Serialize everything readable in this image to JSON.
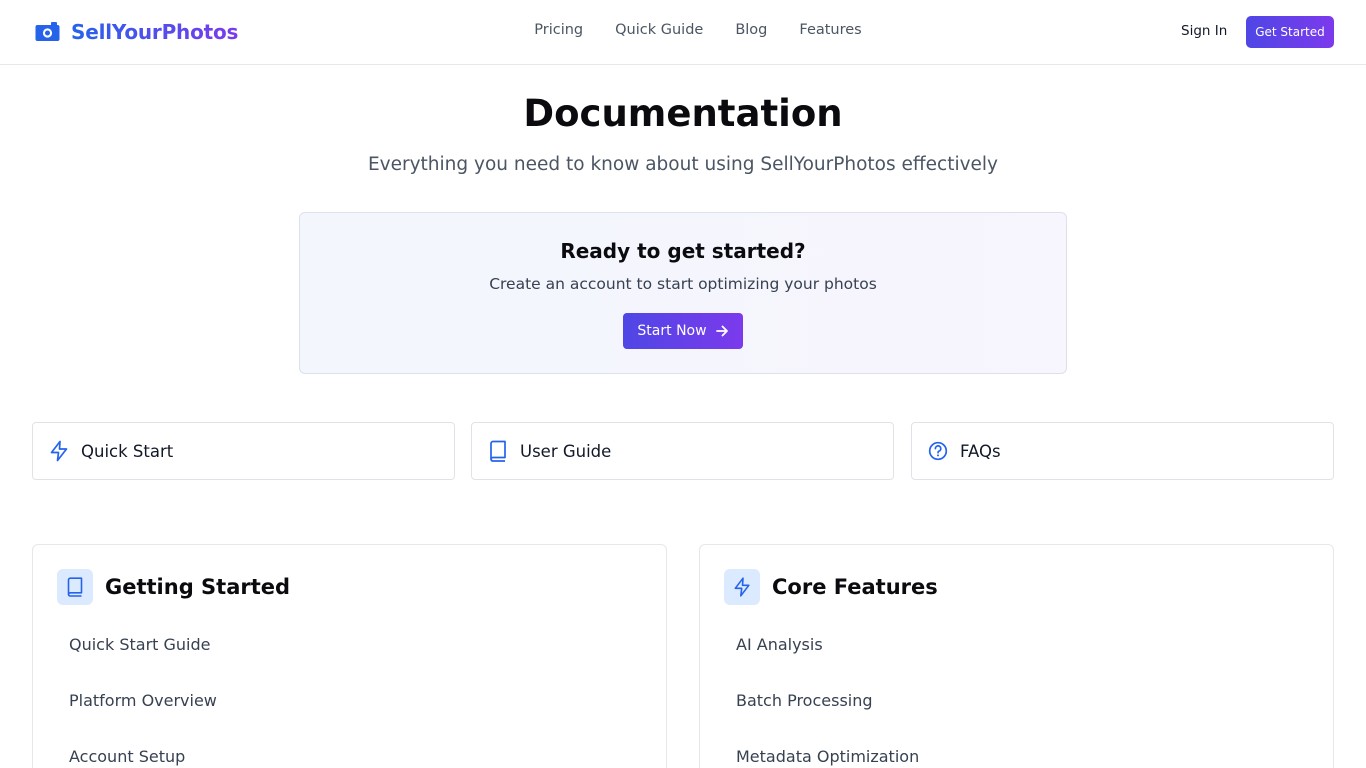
{
  "brand": {
    "name": "SellYourPhotos",
    "icon": "camera-icon",
    "color": "#2563eb"
  },
  "nav": {
    "items": [
      "Pricing",
      "Quick Guide",
      "Blog",
      "Features"
    ]
  },
  "header": {
    "sign_in": "Sign In",
    "get_started": "Get Started"
  },
  "hero": {
    "title": "Documentation",
    "subtitle": "Everything you need to know about using SellYourPhotos effectively"
  },
  "cta": {
    "title": "Ready to get started?",
    "text": "Create an account to start optimizing your photos",
    "button": "Start Now",
    "button_icon": "arrow-right-icon"
  },
  "quick_links": [
    {
      "label": "Quick Start",
      "icon": "lightning-icon"
    },
    {
      "label": "User Guide",
      "icon": "book-icon"
    },
    {
      "label": "FAQs",
      "icon": "help-circle-icon"
    }
  ],
  "sections": [
    {
      "title": "Getting Started",
      "icon": "book-icon",
      "items": [
        "Quick Start Guide",
        "Platform Overview",
        "Account Setup"
      ]
    },
    {
      "title": "Core Features",
      "icon": "lightning-icon",
      "items": [
        "AI Analysis",
        "Batch Processing",
        "Metadata Optimization"
      ]
    }
  ],
  "colors": {
    "accent_start": "#4f46e5",
    "accent_end": "#7c3aed",
    "icon_blue": "#2563eb"
  }
}
